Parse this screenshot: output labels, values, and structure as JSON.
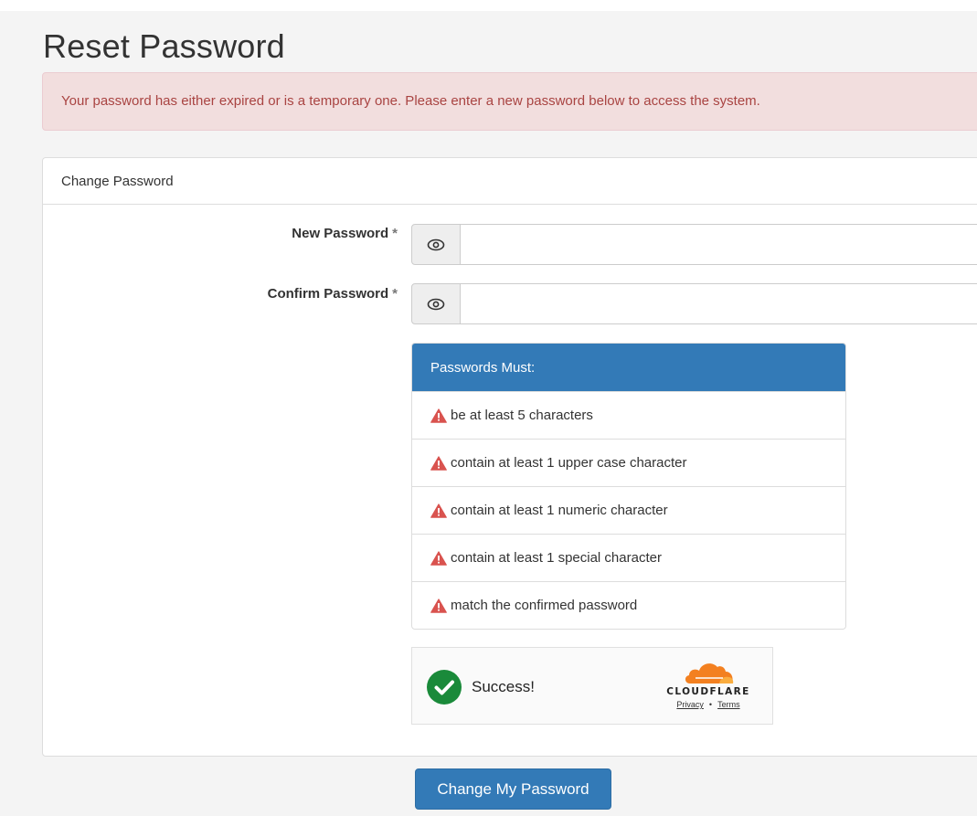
{
  "page": {
    "title": "Reset Password"
  },
  "alert": {
    "message": "Your password has either expired or is a temporary one. Please enter a new password below to access the system."
  },
  "panel": {
    "heading": "Change Password",
    "fields": [
      {
        "label": "New Password",
        "required_mark": "*",
        "value": "",
        "toggle_icon": "eye-icon"
      },
      {
        "label": "Confirm Password",
        "required_mark": "*",
        "value": "",
        "toggle_icon": "eye-icon"
      }
    ],
    "rules": {
      "heading": "Passwords Must:",
      "items": [
        {
          "text": "be at least 5 characters",
          "icon": "warning-icon"
        },
        {
          "text": "contain at least 1 upper case character",
          "icon": "warning-icon"
        },
        {
          "text": "contain at least 1 numeric character",
          "icon": "warning-icon"
        },
        {
          "text": "contain at least 1 special character",
          "icon": "warning-icon"
        },
        {
          "text": "match the confirmed password",
          "icon": "warning-icon"
        }
      ]
    },
    "captcha": {
      "status": "Success!",
      "brand": "CLOUDFLARE",
      "privacy_link": "Privacy",
      "separator": "•",
      "terms_link": "Terms"
    }
  },
  "actions": {
    "submit_label": "Change My Password"
  },
  "colors": {
    "primary": "#337ab7",
    "alert_bg": "#f2dede",
    "alert_text": "#a94442",
    "warning": "#d9534f",
    "success": "#1a8a3a",
    "cloudflare_orange": "#f38020"
  }
}
